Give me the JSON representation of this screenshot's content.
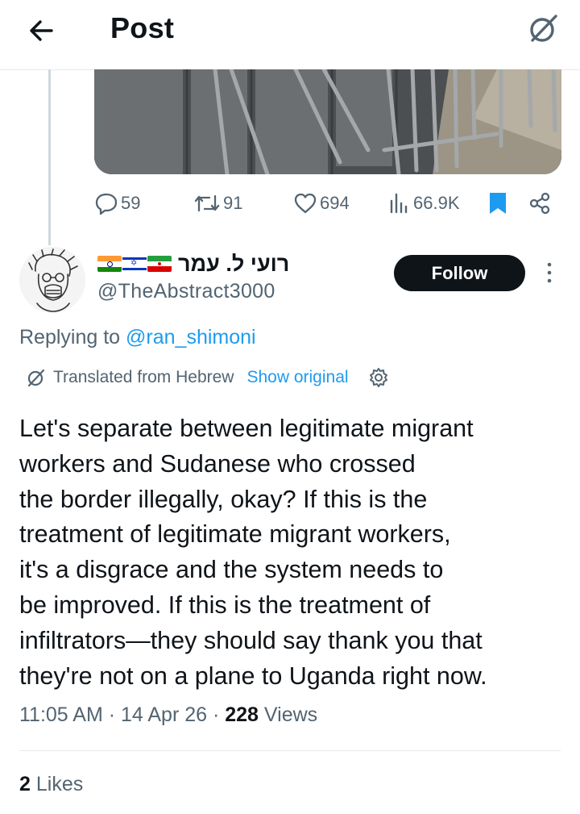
{
  "header": {
    "title": "Post"
  },
  "actions": {
    "replies": "59",
    "reposts": "91",
    "likes": "694",
    "views": "66.9K"
  },
  "post": {
    "display_name": "רועי ל. עמר",
    "flags": [
      "india-flag",
      "israel-flag",
      "iran-flag"
    ],
    "handle": "@TheAbstract3000",
    "follow_label": "Follow",
    "replying_prefix": "Replying to ",
    "replying_handle": "@ran_shimoni",
    "translated_label": "Translated from Hebrew",
    "show_original": "Show original",
    "text": "Let's separate between legitimate migrant\nworkers and Sudanese who crossed\nthe border illegally, okay? If this is the\ntreatment of legitimate migrant workers,\nit's a disgrace and the system needs to\nbe improved. If this is the treatment of\ninfiltrators—they should say thank you that\nthey're not on a plane to Uganda right now.",
    "time": "11:05 AM",
    "date": "14 Apr 26",
    "views_count": "228",
    "views_label": "Views",
    "likes_count": "2",
    "likes_label": "Likes"
  },
  "colors": {
    "accent": "#1d9bf0",
    "muted": "#536471",
    "text": "#0f1419"
  }
}
